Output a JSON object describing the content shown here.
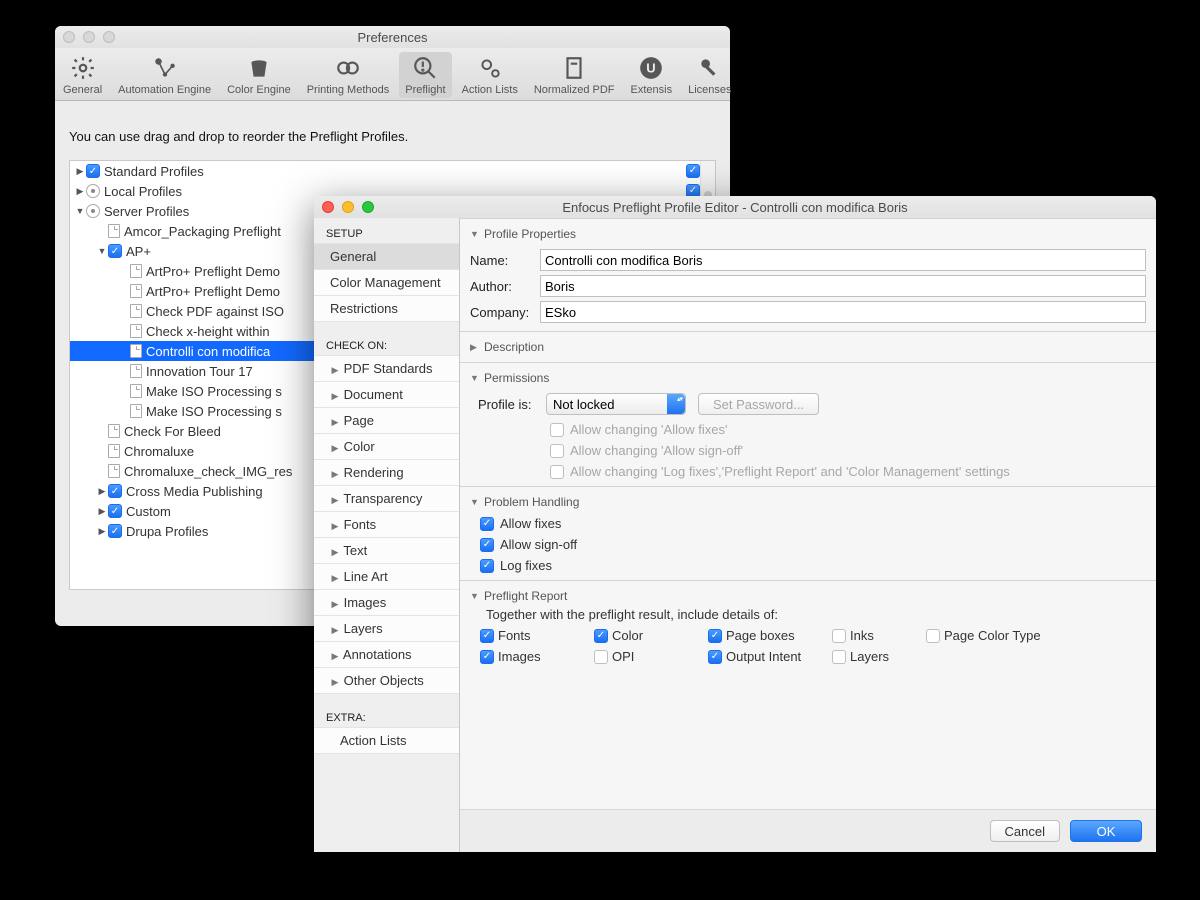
{
  "preferences": {
    "title": "Preferences",
    "toolbar": [
      {
        "id": "general",
        "label": "General"
      },
      {
        "id": "automation",
        "label": "Automation Engine"
      },
      {
        "id": "color-engine",
        "label": "Color Engine"
      },
      {
        "id": "printing",
        "label": "Printing Methods"
      },
      {
        "id": "preflight",
        "label": "Preflight",
        "selected": true
      },
      {
        "id": "actionlists",
        "label": "Action Lists"
      },
      {
        "id": "normalized",
        "label": "Normalized PDF"
      },
      {
        "id": "extensis",
        "label": "Extensis"
      },
      {
        "id": "licenses",
        "label": "Licenses"
      }
    ],
    "hint": "You can use drag and drop to reorder the Preflight Profiles.",
    "tree": [
      {
        "label": "Standard Profiles",
        "level": 0,
        "disc": "▶",
        "kind": "check-on",
        "cb": true,
        "rightcb": true
      },
      {
        "label": "Local Profiles",
        "level": 0,
        "disc": "▶",
        "kind": "user",
        "rightcb": true
      },
      {
        "label": "Server Profiles",
        "level": 0,
        "disc": "▼",
        "kind": "server"
      },
      {
        "label": "Amcor_Packaging Preflight",
        "level": 1,
        "kind": "doc"
      },
      {
        "label": "AP+",
        "level": 1,
        "disc": "▼",
        "kind": "check-on",
        "cb": true
      },
      {
        "label": "ArtPro+ Preflight Demo",
        "level": 2,
        "kind": "doc"
      },
      {
        "label": "ArtPro+ Preflight Demo",
        "level": 2,
        "kind": "doc"
      },
      {
        "label": "Check PDF against ISO",
        "level": 2,
        "kind": "doc"
      },
      {
        "label": "Check x-height within",
        "level": 2,
        "kind": "doc"
      },
      {
        "label": "Controlli con modifica",
        "level": 2,
        "kind": "doc",
        "selected": true
      },
      {
        "label": "Innovation Tour 17",
        "level": 2,
        "kind": "doc"
      },
      {
        "label": "Make ISO Processing s",
        "level": 2,
        "kind": "doc"
      },
      {
        "label": "Make ISO Processing s",
        "level": 2,
        "kind": "doc"
      },
      {
        "label": "Check For Bleed",
        "level": 1,
        "kind": "doc"
      },
      {
        "label": "Chromaluxe",
        "level": 1,
        "kind": "doc"
      },
      {
        "label": "Chromaluxe_check_IMG_res",
        "level": 1,
        "kind": "doc"
      },
      {
        "label": "Cross Media Publishing",
        "level": 1,
        "disc": "▶",
        "kind": "check-on",
        "cb": true
      },
      {
        "label": "Custom",
        "level": 1,
        "disc": "▶",
        "kind": "check-on",
        "cb": true
      },
      {
        "label": "Drupa Profiles",
        "level": 1,
        "disc": "▶",
        "kind": "check-on",
        "cb": true
      }
    ]
  },
  "editor": {
    "title": "Enfocus Preflight Profile Editor - Controlli con modifica Boris",
    "sidebar": {
      "setup_header": "SETUP",
      "setup": [
        {
          "label": "General",
          "selected": true
        },
        {
          "label": "Color Management"
        },
        {
          "label": "Restrictions"
        }
      ],
      "checkon_header": "CHECK ON:",
      "checkon": [
        "PDF Standards",
        "Document",
        "Page",
        "Color",
        "Rendering",
        "Transparency",
        "Fonts",
        "Text",
        "Line Art",
        "Images",
        "Layers",
        "Annotations",
        "Other Objects"
      ],
      "extra_header": "EXTRA:",
      "extra": [
        "Action Lists"
      ]
    },
    "sections": {
      "profile_properties": "Profile Properties",
      "name_label": "Name:",
      "name": "Controlli con modifica Boris",
      "author_label": "Author:",
      "author": "Boris",
      "company_label": "Company:",
      "company": "ESko",
      "description": "Description",
      "permissions": "Permissions",
      "profile_is_label": "Profile is:",
      "lock_options": [
        "Not locked"
      ],
      "lock_selected": "Not locked",
      "set_password": "Set Password...",
      "allow_changing_fixes": "Allow changing 'Allow fixes'",
      "allow_changing_signoff": "Allow changing 'Allow sign-off'",
      "allow_changing_log": "Allow changing 'Log fixes','Preflight Report' and 'Color Management' settings",
      "problem_handling": "Problem Handling",
      "allow_fixes": "Allow fixes",
      "allow_signoff": "Allow sign-off",
      "log_fixes": "Log fixes",
      "preflight_report": "Preflight Report",
      "together": "Together with the preflight result, include details of:",
      "report_checks": [
        {
          "label": "Fonts",
          "on": true
        },
        {
          "label": "Color",
          "on": true
        },
        {
          "label": "Page boxes",
          "on": true
        },
        {
          "label": "Inks",
          "on": false
        },
        {
          "label": "Page Color Type",
          "on": false
        },
        {
          "label": "Images",
          "on": true
        },
        {
          "label": "OPI",
          "on": false
        },
        {
          "label": "Output Intent",
          "on": true
        },
        {
          "label": "Layers",
          "on": false
        }
      ]
    },
    "buttons": {
      "cancel": "Cancel",
      "ok": "OK"
    }
  }
}
